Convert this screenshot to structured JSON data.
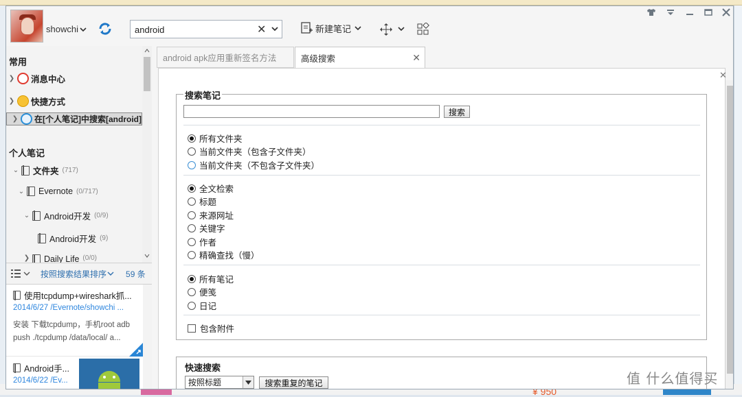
{
  "window": {
    "user": {
      "name": "showchi"
    },
    "search": {
      "value": "android",
      "clear": "✕"
    },
    "toolbar": {
      "new_note": "新建笔记"
    },
    "controls": [
      "shirt-icon",
      "menu-icon",
      "minimize-icon",
      "maximize-icon",
      "close-icon"
    ]
  },
  "sidebar": {
    "section_common": "常用",
    "items": [
      {
        "label": "消息中心",
        "icon": "message-center-icon",
        "color": "#e03a2f"
      },
      {
        "label": "快捷方式",
        "icon": "shortcut-icon",
        "color": "#f2a500"
      },
      {
        "label": "在[个人笔记]中搜索[android]",
        "icon": "search-icon",
        "color": "#2a8fd8"
      }
    ],
    "section_personal": "个人笔记",
    "tree": [
      {
        "label": "文件夹",
        "count": "(717)"
      },
      {
        "label": "Evernote",
        "count": "(0/717)"
      },
      {
        "label": "Android开发",
        "count": "(0/9)"
      },
      {
        "label": "Android开发",
        "count": "(9)"
      },
      {
        "label": "Daily Life",
        "count": "(0/0)"
      }
    ],
    "sort_label": "按照搜索结果排序",
    "count_label": "59 条",
    "notes": [
      {
        "title": "使用tcpdump+wireshark抓...",
        "meta": "2014/6/27   /Evernote/showchi ...",
        "line1": "安装 下载tcpdump，手机root adb",
        "line2": "push ./tcpdump /data/local/ a..."
      },
      {
        "title": "Android手...",
        "meta": "2014/6/22   /Ev..."
      }
    ]
  },
  "tabs": [
    {
      "label": "android apk应用重新签名方法"
    },
    {
      "label": "高级搜索",
      "close": "✕"
    }
  ],
  "advanced": {
    "search_legend": "搜索笔记",
    "search_button": "搜索",
    "scope": [
      "所有文件夹",
      "当前文件夹（包含子文件夹）",
      "当前文件夹（不包含子文件夹）"
    ],
    "fields": [
      "全文检索",
      "标题",
      "来源网址",
      "关键字",
      "作者",
      "精确查找（慢）"
    ],
    "types": [
      "所有笔记",
      "便笺",
      "日记"
    ],
    "attach": "包含附件",
    "quick_legend": "快速搜索",
    "quick_select": "按照标题",
    "quick_button": "搜索重复的笔记",
    "close": "✕"
  },
  "background": {
    "watermark": "值 什么值得买",
    "price": "¥ 950"
  }
}
